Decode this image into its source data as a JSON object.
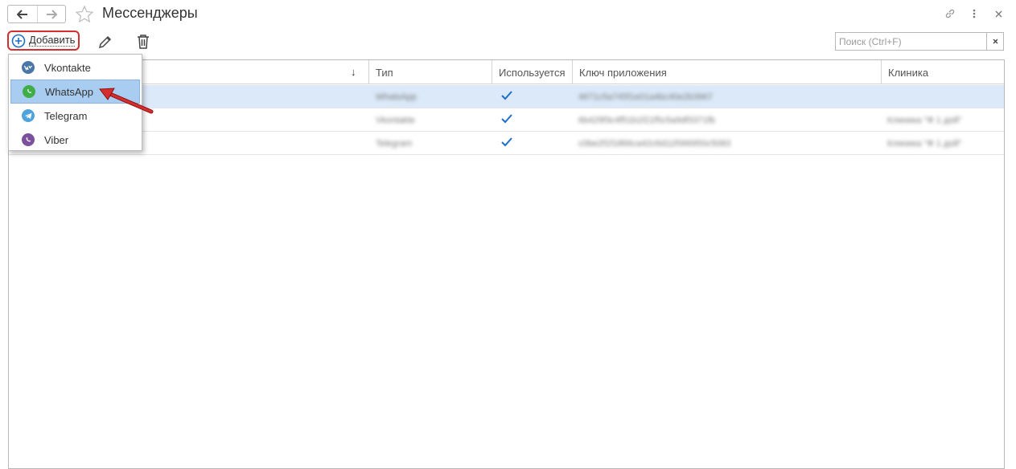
{
  "window": {
    "title": "Мессенджеры"
  },
  "toolbar": {
    "add_label": "Добавить",
    "search_placeholder": "Поиск (Ctrl+F)"
  },
  "table": {
    "columns": [
      "Тип",
      "Используется",
      "Ключ приложения",
      "Клиника"
    ],
    "rows": [
      {
        "name": "",
        "type": "WhatsApp",
        "used": true,
        "key": "4671c5a745f1e01a4bc40e2b3967",
        "clinic": ""
      },
      {
        "name": "",
        "type": "Vkontakte",
        "used": true,
        "key": "6b429f3c4f51b1f21f5c5a9df3371fb",
        "clinic": "Клиника \"Ф 1 дой\""
      },
      {
        "name": "",
        "type": "Telegram",
        "used": true,
        "key": "c0be2f1f1866ca42c6d11f066950c5083",
        "clinic": "Клиника \"Ф 1 дой\""
      }
    ]
  },
  "dropdown": {
    "items": [
      {
        "label": "Vkontakte",
        "icon": "vk-icon",
        "color": "#4a76a8"
      },
      {
        "label": "WhatsApp",
        "icon": "whatsapp-icon",
        "color": "#3fae49"
      },
      {
        "label": "Telegram",
        "icon": "telegram-icon",
        "color": "#4fa3dd"
      },
      {
        "label": "Viber",
        "icon": "viber-icon",
        "color": "#7b519d"
      }
    ]
  },
  "colors": {
    "accent_check": "#1f6ec9",
    "annotation_red": "#d32f2f",
    "selection": "#dbe9f8"
  }
}
